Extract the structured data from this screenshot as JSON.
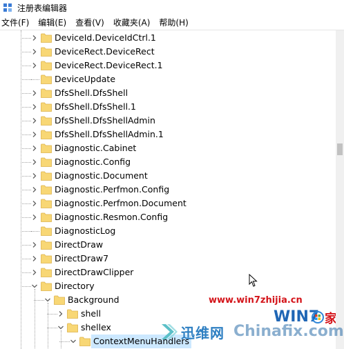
{
  "window": {
    "title": "注册表编辑器"
  },
  "menu": [
    "文件(F)",
    "编辑(E)",
    "查看(V)",
    "收藏夹(A)",
    "帮助(H)"
  ],
  "tree": [
    {
      "label": "DeviceId.DeviceIdCtrl.1",
      "level": 1,
      "state": "collapsed"
    },
    {
      "label": "DeviceRect.DeviceRect",
      "level": 1,
      "state": "collapsed"
    },
    {
      "label": "DeviceRect.DeviceRect.1",
      "level": 1,
      "state": "collapsed"
    },
    {
      "label": "DeviceUpdate",
      "level": 1,
      "state": "leaf"
    },
    {
      "label": "DfsShell.DfsShell",
      "level": 1,
      "state": "collapsed"
    },
    {
      "label": "DfsShell.DfsShell.1",
      "level": 1,
      "state": "collapsed"
    },
    {
      "label": "DfsShell.DfsShellAdmin",
      "level": 1,
      "state": "collapsed"
    },
    {
      "label": "DfsShell.DfsShellAdmin.1",
      "level": 1,
      "state": "collapsed"
    },
    {
      "label": "Diagnostic.Cabinet",
      "level": 1,
      "state": "collapsed"
    },
    {
      "label": "Diagnostic.Config",
      "level": 1,
      "state": "collapsed"
    },
    {
      "label": "Diagnostic.Document",
      "level": 1,
      "state": "collapsed"
    },
    {
      "label": "Diagnostic.Perfmon.Config",
      "level": 1,
      "state": "collapsed"
    },
    {
      "label": "Diagnostic.Perfmon.Document",
      "level": 1,
      "state": "collapsed"
    },
    {
      "label": "Diagnostic.Resmon.Config",
      "level": 1,
      "state": "collapsed"
    },
    {
      "label": "DiagnosticLog",
      "level": 1,
      "state": "leaf"
    },
    {
      "label": "DirectDraw",
      "level": 1,
      "state": "collapsed"
    },
    {
      "label": "DirectDraw7",
      "level": 1,
      "state": "collapsed"
    },
    {
      "label": "DirectDrawClipper",
      "level": 1,
      "state": "collapsed"
    },
    {
      "label": "Directory",
      "level": 1,
      "state": "expanded"
    },
    {
      "label": "Background",
      "level": 2,
      "state": "expanded"
    },
    {
      "label": "shell",
      "level": 3,
      "state": "collapsed"
    },
    {
      "label": "shellex",
      "level": 3,
      "state": "expanded"
    },
    {
      "label": "ContextMenuHandlers",
      "level": 4,
      "state": "expanded",
      "selected": true
    }
  ],
  "watermark": {
    "url": "www.win7zhijia.cn",
    "logo_text": "WIN7",
    "logo_suffix": "家",
    "brand": "迅维网",
    "site": "Chinafix.com"
  },
  "colors": {
    "chevron": "#5f5f5f",
    "folder_fill": "#f8d775",
    "folder_edge": "#dcb24b",
    "selection": "#cce8ff",
    "watermark_red": "#d4141a",
    "watermark_blue": "#2e7fc2"
  }
}
